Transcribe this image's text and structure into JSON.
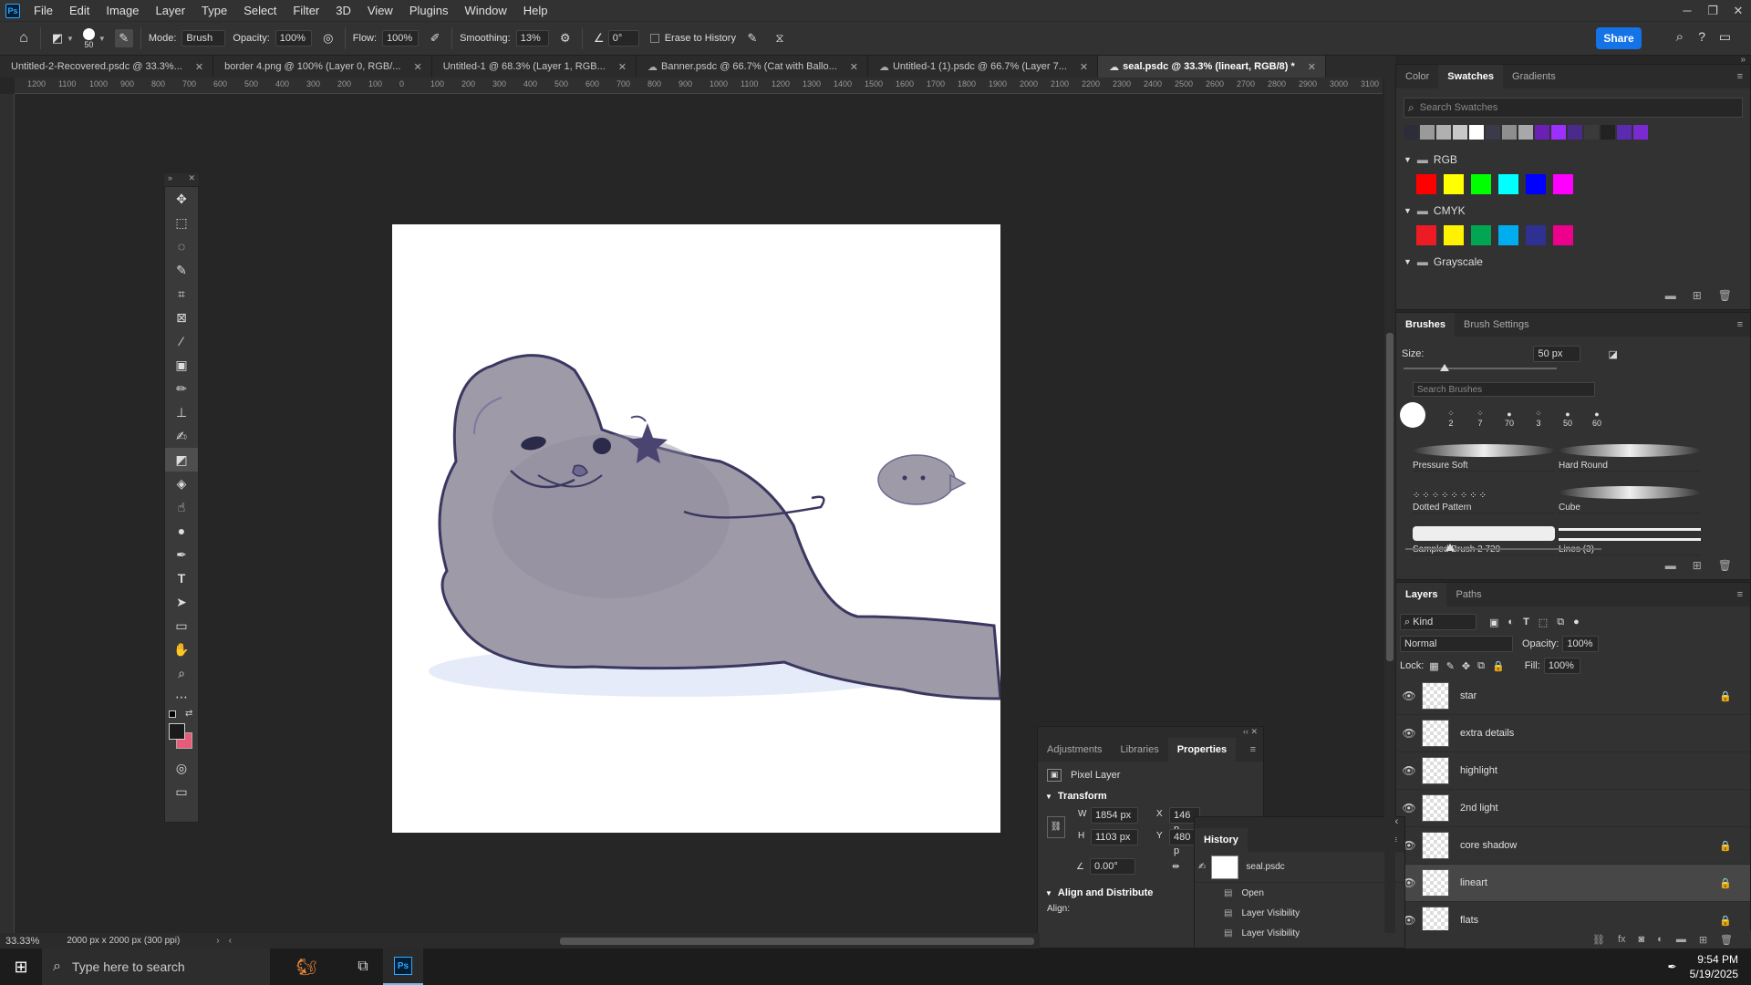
{
  "app": {
    "menu": [
      "File",
      "Edit",
      "Image",
      "Layer",
      "Type",
      "Select",
      "Filter",
      "3D",
      "View",
      "Plugins",
      "Window",
      "Help"
    ]
  },
  "options": {
    "brush_size": "50",
    "mode_label": "Mode:",
    "mode_value": "Brush",
    "opacity_label": "Opacity:",
    "opacity_value": "100%",
    "flow_label": "Flow:",
    "flow_value": "100%",
    "smoothing_label": "Smoothing:",
    "smoothing_value": "13%",
    "angle_value": "0°",
    "erase_history_label": "Erase to History",
    "share_label": "Share"
  },
  "tabs": [
    {
      "label": "Untitled-2-Recovered.psdc @ 33.3%..."
    },
    {
      "label": "border 4.png @ 100% (Layer 0, RGB/..."
    },
    {
      "label": "Untitled-1 @ 68.3% (Layer 1, RGB..."
    },
    {
      "label": "Banner.psdc @ 66.7% (Cat with Ballo..."
    },
    {
      "label": "Untitled-1 (1).psdc @ 66.7% (Layer 7..."
    },
    {
      "label": "seal.psdc @ 33.3% (lineart, RGB/8) *"
    }
  ],
  "ruler_ticks": [
    "1200",
    "1100",
    "1000",
    "900",
    "800",
    "700",
    "600",
    "500",
    "400",
    "300",
    "200",
    "100",
    "0",
    "100",
    "200",
    "300",
    "400",
    "500",
    "600",
    "700",
    "800",
    "900",
    "1000",
    "1100",
    "1200",
    "1300",
    "1400",
    "1500",
    "1600",
    "1700",
    "1800",
    "1900",
    "2000",
    "2100",
    "2200",
    "2300",
    "2400",
    "2500",
    "2600",
    "2700",
    "2800",
    "2900",
    "3000",
    "3100",
    "32"
  ],
  "swatches_panel": {
    "tabs": [
      "Color",
      "Swatches",
      "Gradients"
    ],
    "search_placeholder": "Search Swatches",
    "recent": [
      "#2d2d3a",
      "#9a9a9a",
      "#b0b0b0",
      "#c8c8c8",
      "#ffffff",
      "#3a3a4a",
      "#8e8e8e",
      "#a8a8a8",
      "#6a1fb5",
      "#9b30ff",
      "#4a2a8a",
      "#3a3a3a",
      "#222222",
      "#5a2ab0",
      "#7a2ad0"
    ],
    "groups": [
      {
        "name": "RGB",
        "colors": [
          "#ff0000",
          "#ffff00",
          "#00ff00",
          "#00ffff",
          "#0000ff",
          "#ff00ff"
        ]
      },
      {
        "name": "CMYK",
        "colors": [
          "#ed1c24",
          "#fff200",
          "#00a651",
          "#00aeef",
          "#2e3192",
          "#ec008c"
        ]
      },
      {
        "name": "Grayscale",
        "colors": []
      }
    ]
  },
  "brushes_panel": {
    "tabs": [
      "Brushes",
      "Brush Settings"
    ],
    "size_label": "Size:",
    "size_value": "50 px",
    "search_placeholder": "Search Brushes",
    "recent_sizes": [
      "2",
      "7",
      "70",
      "3",
      "50",
      "60"
    ],
    "brushes": [
      "Pressure Soft",
      "Hard Round",
      "Dotted Pattern",
      "Cube",
      "Sampled Brush 2 729",
      "Lines (3)"
    ]
  },
  "layers_panel": {
    "tabs": [
      "Layers",
      "Paths"
    ],
    "filter_kind": "Kind",
    "blend_mode": "Normal",
    "opacity_label": "Opacity:",
    "opacity_value": "100%",
    "lock_label": "Lock:",
    "fill_label": "Fill:",
    "fill_value": "100%",
    "layers": [
      {
        "name": "star",
        "locked": true
      },
      {
        "name": "extra details",
        "locked": false
      },
      {
        "name": "highlight",
        "locked": false
      },
      {
        "name": "2nd light",
        "locked": false
      },
      {
        "name": "core shadow",
        "locked": true
      },
      {
        "name": "lineart",
        "locked": true
      },
      {
        "name": "flats",
        "locked": true
      }
    ]
  },
  "properties_panel": {
    "tabs": [
      "Adjustments",
      "Libraries",
      "Properties"
    ],
    "layer_type": "Pixel Layer",
    "transform_label": "Transform",
    "w_label": "W",
    "w_value": "1854 px",
    "h_label": "H",
    "h_value": "1103 px",
    "x_label": "X",
    "x_value": "146 p",
    "y_label": "Y",
    "y_value": "480 p",
    "angle_value": "0.00°",
    "align_section": "Align and Distribute",
    "align_label": "Align:"
  },
  "history_panel": {
    "title": "History",
    "snapshot": "seal.psdc",
    "items": [
      "Open",
      "Layer Visibility",
      "Layer Visibility"
    ]
  },
  "status": {
    "zoom": "33.33%",
    "doc_info": "2000 px x 2000 px (300 ppi)"
  },
  "taskbar": {
    "search_placeholder": "Type here to search",
    "time": "9:54 PM",
    "date": "5/19/2025"
  },
  "colors": {
    "accent": "#1473e6",
    "foreground": "#1a1a1a",
    "background": "#e85b78"
  }
}
